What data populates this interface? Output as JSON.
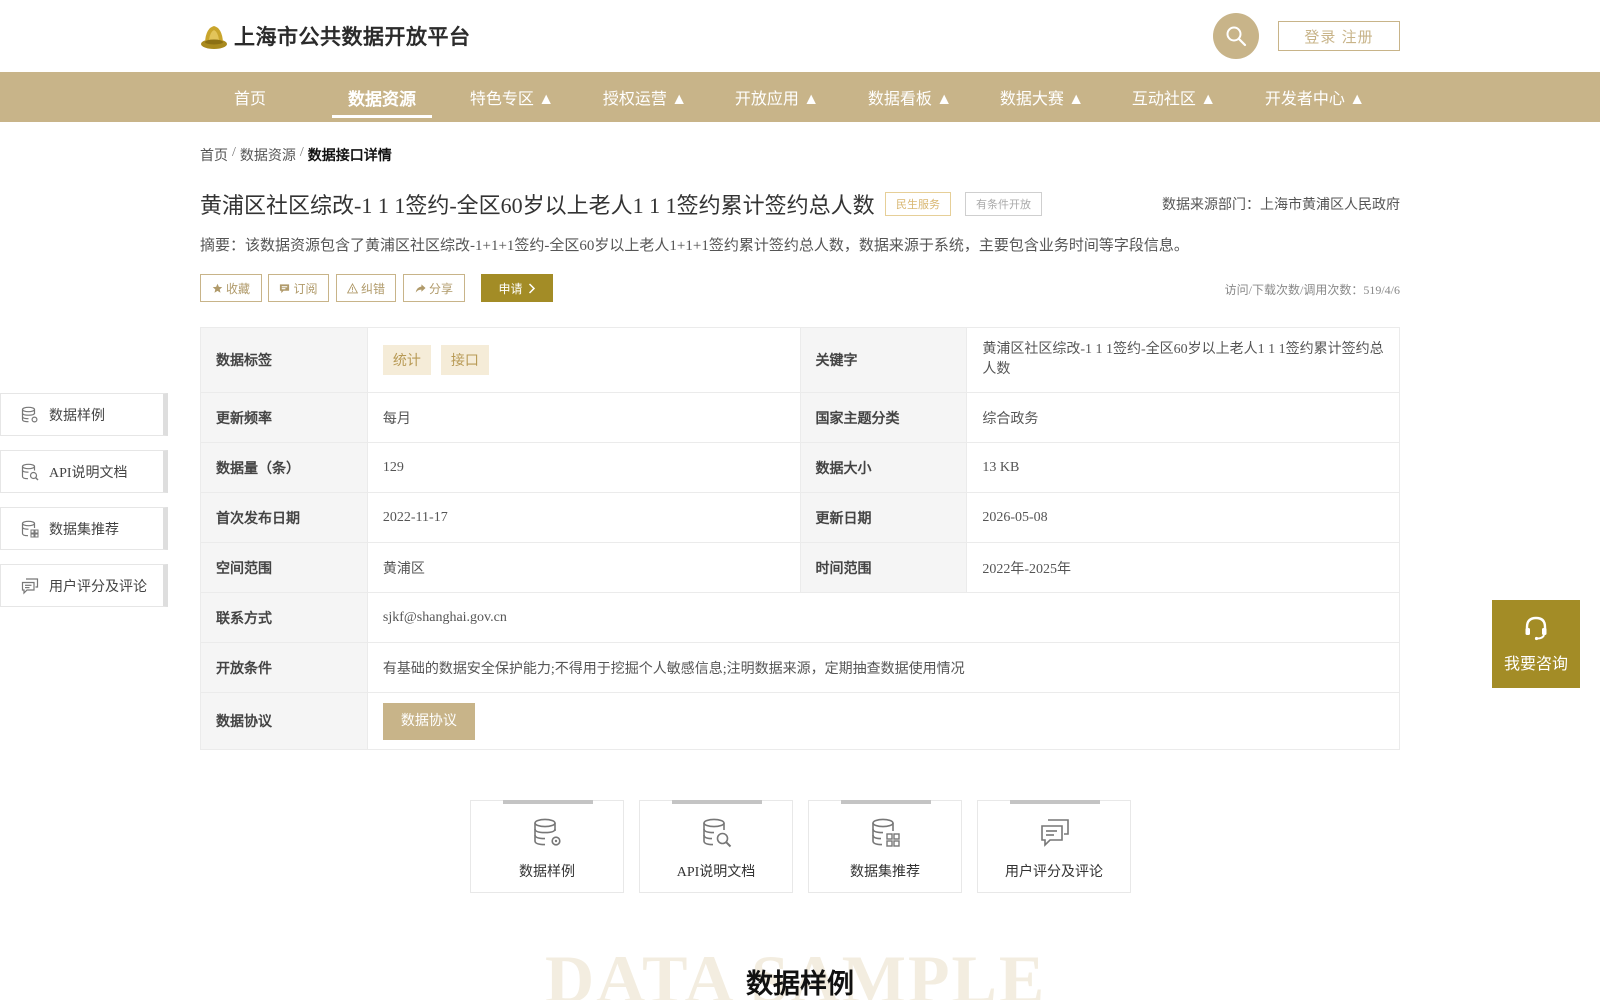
{
  "header": {
    "site_title": "上海市公共数据开放平台",
    "login_label": "登录 注册",
    "logo_icon": "gold-ingot-logo-icon",
    "search_icon": "search-icon"
  },
  "nav": {
    "items": [
      {
        "label": "首页"
      },
      {
        "label": "数据资源"
      },
      {
        "label": "特色专区 ▲"
      },
      {
        "label": "授权运营 ▲"
      },
      {
        "label": "开放应用 ▲"
      },
      {
        "label": "数据看板 ▲"
      },
      {
        "label": "数据大赛 ▲"
      },
      {
        "label": "互动社区 ▲"
      },
      {
        "label": "开发者中心 ▲"
      }
    ],
    "active_index": 1
  },
  "breadcrumb": {
    "home": "首页",
    "sep": "/",
    "resources": "数据资源",
    "current": "数据接口详情"
  },
  "dataset": {
    "title": "黄浦区社区综改-1 1 1签约-全区60岁以上老人1 1 1签约累计签约总人数",
    "tag_service": "民生服务",
    "tag_open": "有条件开放",
    "source_dept": "数据来源部门：上海市黄浦区人民政府",
    "summary": "摘要：该数据资源包含了黄浦区社区综改-1+1+1签约-全区60岁以上老人1+1+1签约累计签约总人数，数据来源于系统，主要包含业务时间等字段信息。"
  },
  "actions": {
    "collect": "收藏",
    "subscribe": "订阅",
    "correct": "纠错",
    "share": "分享",
    "apply": "申请",
    "counts": "访问/下载次数/调用次数：519/4/6"
  },
  "table": {
    "tags_label": "数据标签",
    "tags": [
      "统计",
      "接口"
    ],
    "keyword_label": "关键字",
    "keyword_value": "黄浦区社区综改-1 1 1签约-全区60岁以上老人1 1 1签约累计签约总人数",
    "freq_label": "更新频率",
    "freq_value": "每月",
    "theme_label": "国家主题分类",
    "theme_value": "综合政务",
    "count_label": "数据量（条）",
    "count_value": "129",
    "size_label": "数据大小",
    "size_value": "13 KB",
    "first_label": "首次发布日期",
    "first_value": "2022-11-17",
    "update_label": "更新日期",
    "update_value": "2026-05-08",
    "space_label": "空间范围",
    "space_value": "黄浦区",
    "time_label": "时间范围",
    "time_value": "2022年-2025年",
    "contact_label": "联系方式",
    "contact_value": "sjkf@shanghai.gov.cn",
    "cond_label": "开放条件",
    "cond_value": "有基础的数据安全保护能力;不得用于挖掘个人敏感信息;注明数据来源，定期抽查数据使用情况",
    "protocol_label": "数据协议",
    "protocol_button": "数据协议"
  },
  "side_nav": [
    {
      "label": "数据样例",
      "icon": "database-gear-icon"
    },
    {
      "label": "API说明文档",
      "icon": "database-search-icon"
    },
    {
      "label": "数据集推荐",
      "icon": "database-grid-icon"
    },
    {
      "label": "用户评分及评论",
      "icon": "comment-icon"
    }
  ],
  "consult": {
    "label": "我要咨询",
    "icon": "headset-icon"
  },
  "cards": [
    {
      "label": "数据样例",
      "icon": "database-gear-icon"
    },
    {
      "label": "API说明文档",
      "icon": "database-search-icon"
    },
    {
      "label": "数据集推荐",
      "icon": "database-grid-icon"
    },
    {
      "label": "用户评分及评论",
      "icon": "comment-icon"
    }
  ],
  "section": {
    "watermark": "DATA SAMPLE",
    "title": "数据样例"
  },
  "colors": {
    "brand": "#c8b489",
    "accent_dark": "#a38c26",
    "chip_bg": "#f5ecd8"
  }
}
